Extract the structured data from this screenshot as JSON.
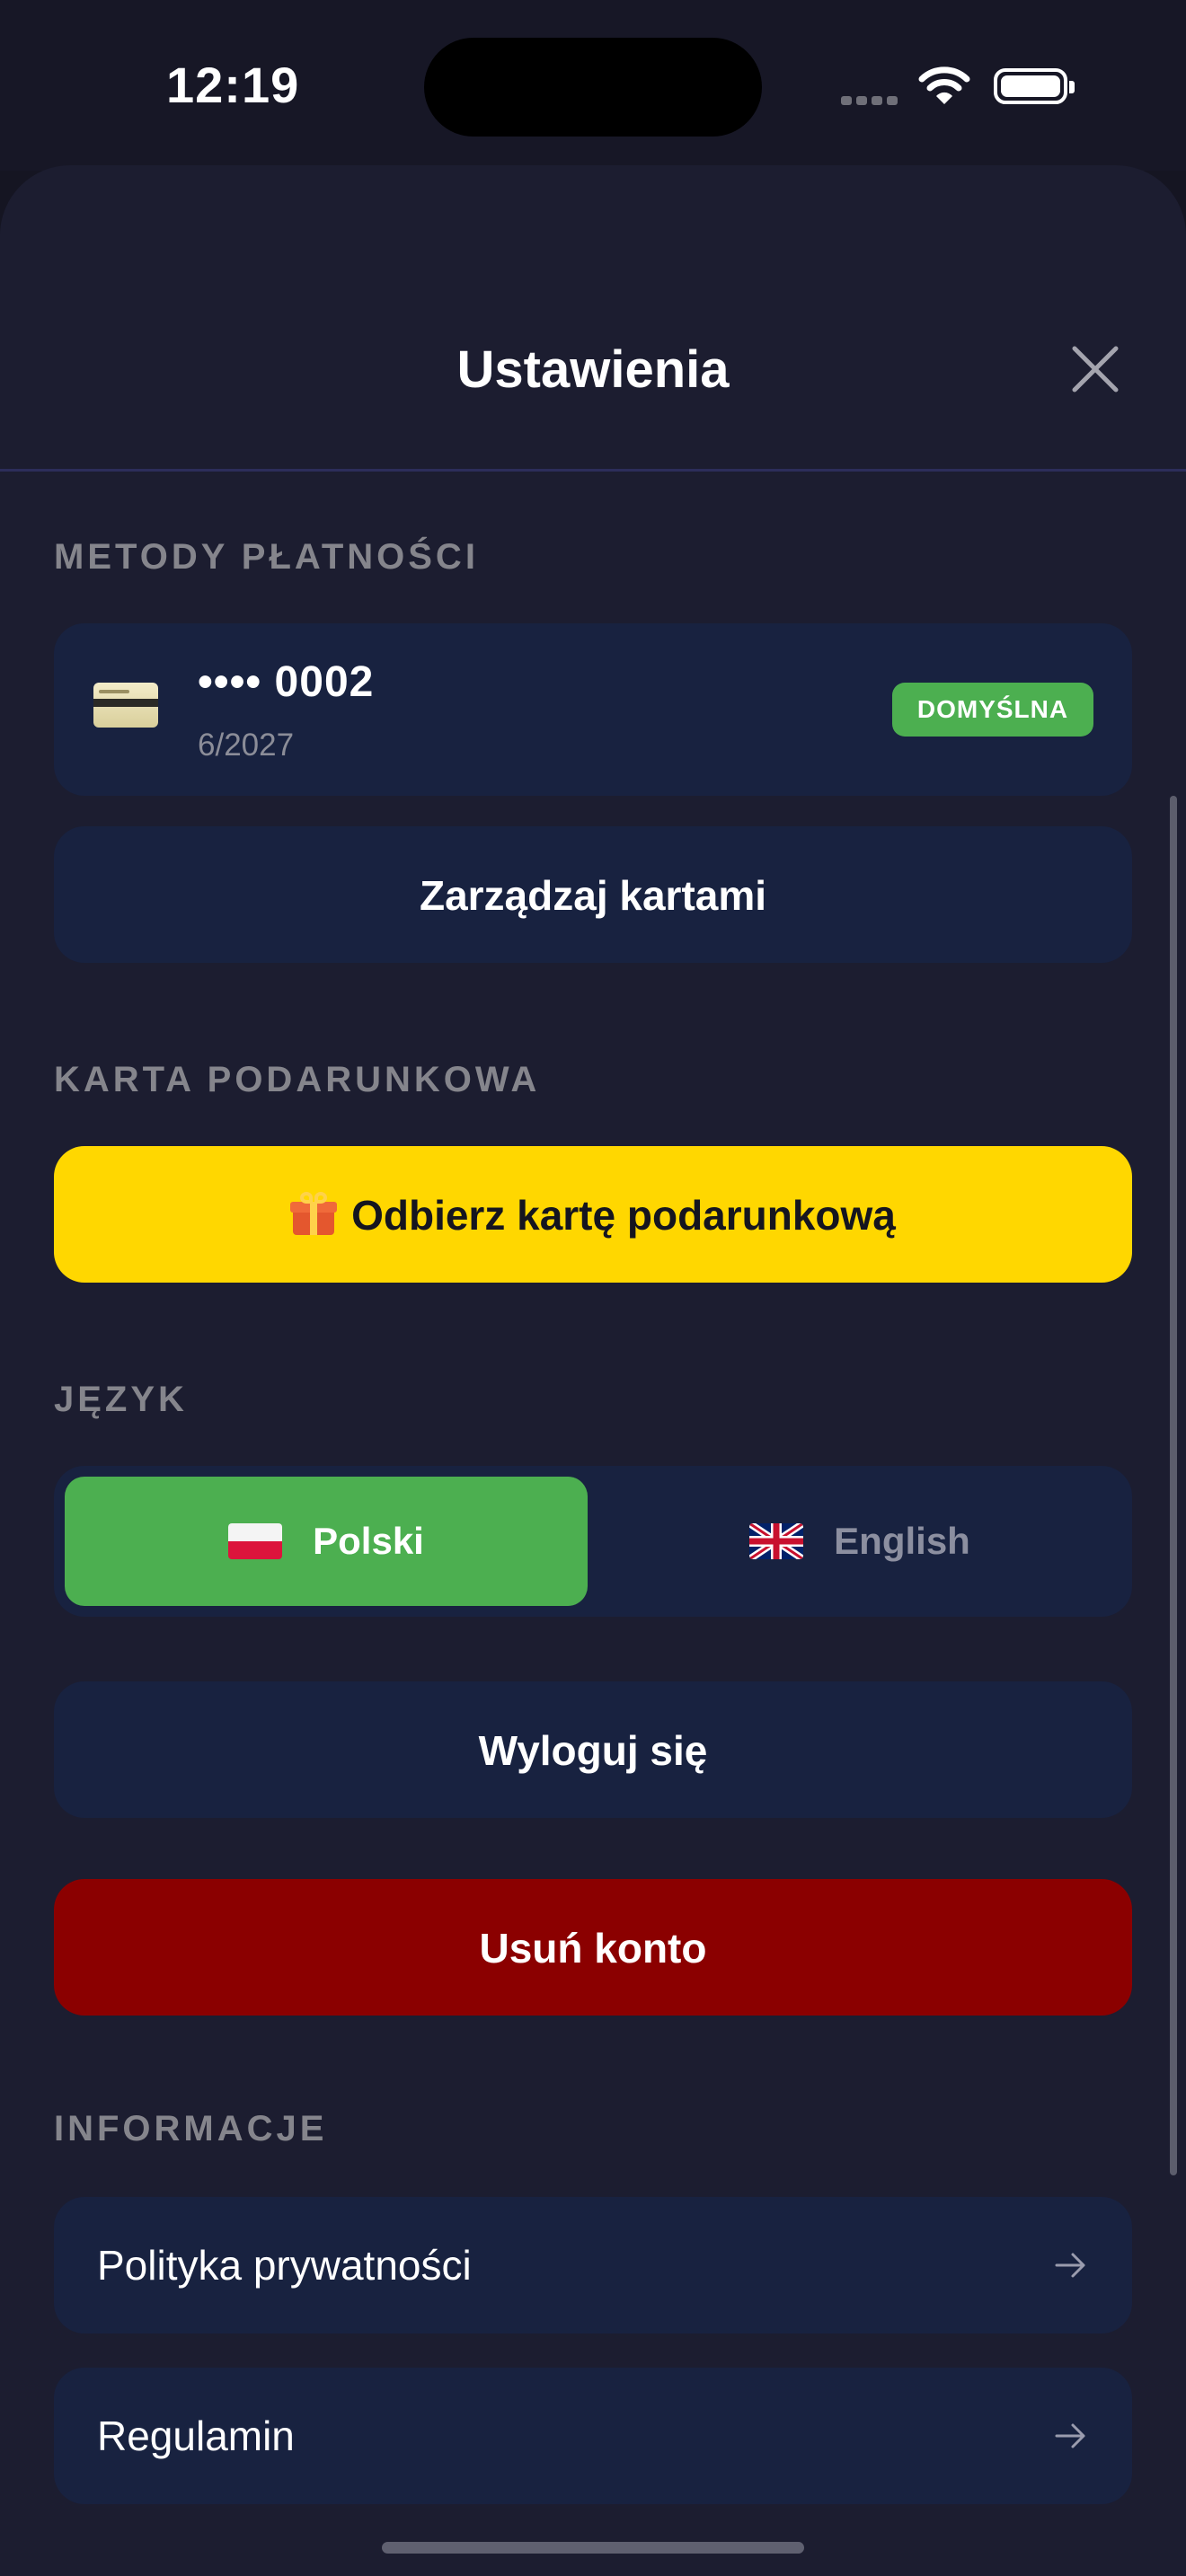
{
  "status_bar": {
    "time": "12:19"
  },
  "header": {
    "title": "Ustawienia",
    "close_icon": "close-icon"
  },
  "payment": {
    "section_label": "METODY PŁATNOŚCI",
    "card_number": "•••• 0002",
    "card_expiry": "6/2027",
    "default_badge": "DOMYŚLNA",
    "manage_label": "Zarządzaj kartami"
  },
  "gift": {
    "section_label": "KARTA PODARUNKOWA",
    "button_label": "Odbierz kartę podarunkową",
    "button_color": "#FFD700"
  },
  "language": {
    "section_label": "JĘZYK",
    "options": [
      {
        "label": "Polski",
        "selected": true
      },
      {
        "label": "English",
        "selected": false
      }
    ],
    "selected_color": "#4CAF50"
  },
  "account": {
    "logout_label": "Wyloguj się",
    "delete_label": "Usuń konto",
    "delete_color": "#8B0000"
  },
  "info": {
    "section_label": "INFORMACJE",
    "items": [
      {
        "label": "Polityka prywatności",
        "icon": "arrow-right-icon"
      },
      {
        "label": "Regulamin",
        "icon": "arrow-right-icon"
      }
    ]
  }
}
